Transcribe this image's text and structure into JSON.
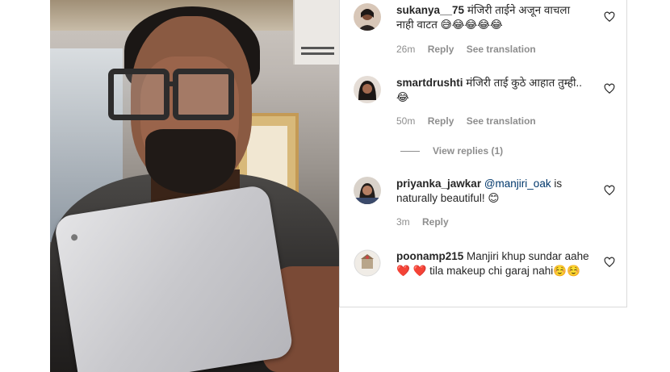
{
  "comments": [
    {
      "username": "sukanya__75",
      "text": "मंजिरी ताईने अजून वाचला नाही वाटत 😅😂😂😂😂",
      "time": "26m",
      "reply_label": "Reply",
      "translate_label": "See translation"
    },
    {
      "username": "smartdrushti",
      "text": "मंजिरी ताई कुठे आहात तुम्ही..😂",
      "time": "50m",
      "reply_label": "Reply",
      "translate_label": "See translation",
      "view_replies": "View replies (1)"
    },
    {
      "username": "priyanka_jawkar",
      "mention": "@manjiri_oak",
      "text": "is naturally beautiful! 😊",
      "time": "3m",
      "reply_label": "Reply"
    },
    {
      "username": "poonamp215",
      "text": "Manjiri khup sundar aahe ❤️ ❤️ tila makeup chi garaj nahi☺️☺️"
    }
  ],
  "colors": {
    "text": "#262626",
    "meta": "#8e8e8e",
    "mention": "#00376b",
    "border": "#dbdbdb"
  },
  "icons": [
    "heart-icon",
    "apple-logo-icon"
  ]
}
